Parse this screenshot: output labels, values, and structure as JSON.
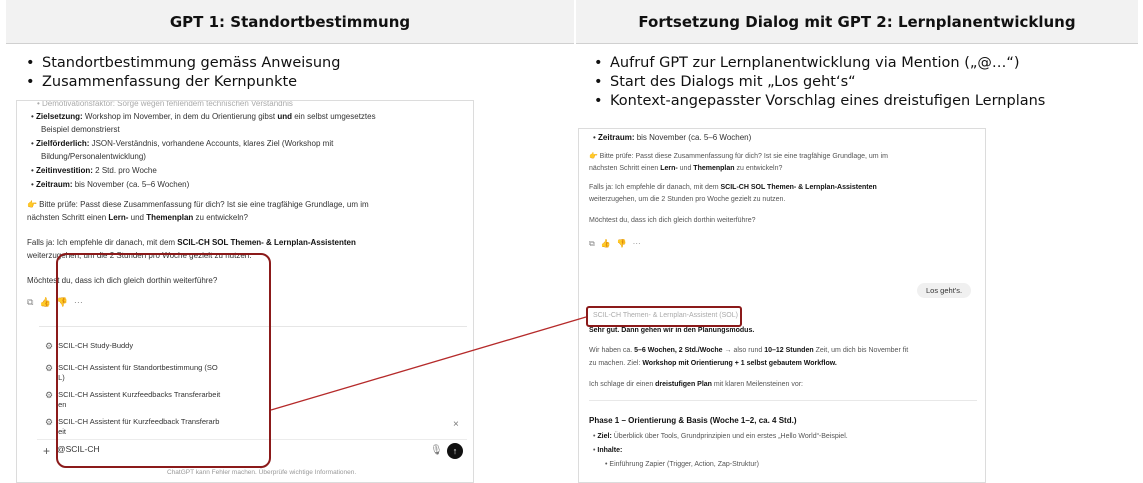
{
  "headers": {
    "left": "GPT 1: Standortbestimmung",
    "right": "Fortsetzung Dialog mit GPT 2: Lernplanentwicklung"
  },
  "bullets_left": [
    "Standortbestimmung gemäss Anweisung",
    "Zusammenfassung der Kernpunkte"
  ],
  "bullets_right": [
    "Aufruf GPT zur Lernplanentwicklung via Mention („@…“)",
    "Start des Dialogs mit „Los geht‘s“",
    "Kontext-angepasster Vorschlag eines dreistufigen Lernplans"
  ],
  "left_screenshot": {
    "cut_top_line": "Demotivationsfaktor: Sorge wegen fehlendem technischen Verständnis",
    "bullets": [
      {
        "bold": "Zielsetzung:",
        "text_1": " Workshop im November, in dem du Orientierung gibst ",
        "bold_2": "und",
        "text_2": " ein selbst umgesetztes"
      },
      {
        "cont": "Beispiel demonstrierst"
      },
      {
        "bold": "Zielförderlich:",
        "text_1": " JSON-Verständnis, vorhandene Accounts, klares Ziel (Workshop mit"
      },
      {
        "cont": "Bildung/Personalentwicklung)"
      },
      {
        "bold": "Zeitinvestition:",
        "text_1": " 2 Std. pro Woche"
      },
      {
        "bold": "Zeitraum:",
        "text_1": " bis November (ca. 5–6 Wochen)"
      }
    ],
    "check_prefix": "👉 Bitte prüfe: Passt diese Zusammenfassung für dich? Ist sie eine tragfähige Grundlage, um im",
    "check_line2_a": "nächsten Schritt einen ",
    "check_line2_b": "Lern-",
    "check_line2_c": " und ",
    "check_line2_d": "Themenplan",
    "check_line2_e": " zu entwickeln?",
    "ifyes_a": "Falls ja: Ich empfehle dir danach, mit dem ",
    "ifyes_b": "SCIL-CH SOL Themen- & Lernplan-Assistenten",
    "ifyes_line2": "weiterzugehen, um die 2 Stunden pro Woche gezielt zu nutzen.",
    "question": "Möchtest du, dass ich dich gleich dorthin weiterführe?",
    "action_icons": "⧉  ♡  ♡  ···",
    "suggestions": [
      "SCIL-CH Study-Buddy",
      "SCIL-CH Assistent für Standortbestimmung (SO",
      "L)",
      "SCIL-CH Assistent Kurzfeedbacks Transferarbeit",
      "en",
      "SCIL-CH Assistent für Kurzfeedback Transferarb",
      "eit"
    ],
    "close_symbol": "×",
    "input_value": "@SCIL-CH",
    "footer": "ChatGPT kann Fehler machen. Überprüfe wichtige Informationen."
  },
  "right_screenshot": {
    "timeframe_bold": "Zeitraum:",
    "timeframe_text": " bis November (ca. 5–6 Wochen)",
    "check_line1": "👉 Bitte prüfe: Passt diese Zusammenfassung für dich? Ist sie eine tragfähige Grundlage, um im",
    "check_line2_a": "nächsten Schritt einen ",
    "check_line2_b": "Lern-",
    "check_line2_c": " und ",
    "check_line2_d": "Themenplan",
    "check_line2_e": " zu entwickeln?",
    "ifyes_a": "Falls ja: Ich empfehle dir danach, mit dem ",
    "ifyes_b": "SCIL-CH SOL Themen- & Lernplan-Assistenten",
    "ifyes_line2": "weiterzugehen, um die 2 Stunden pro Woche gezielt zu nutzen.",
    "question": "Möchtest du, dass ich dich gleich dorthin weiterführe?",
    "action_icons": "⧉  ♡  ♡  ···",
    "user_bubble": "Los geht's.",
    "assistant_label": "SCIL-CH Themen- & Lernplan-Assistent (SOL)",
    "intro_bold": "Sehr gut. Dann gehen wir in den Planungsmodus.",
    "p2_a": "Wir haben ca. ",
    "p2_b": "5–6 Wochen, 2 Std./Woche",
    "p2_c": " → also rund ",
    "p2_d": "10–12 Stunden",
    "p2_e": " Zeit, um dich bis November fit",
    "p2_line2_a": "zu machen. Ziel: ",
    "p2_line2_b": "Workshop mit Orientierung + 1 selbst gebautem Workflow.",
    "p3_a": "Ich schlage dir einen ",
    "p3_b": "dreistufigen Plan",
    "p3_c": " mit klaren Meilensteinen vor:",
    "phase_title": "Phase 1 – Orientierung & Basis (Woche 1–2, ca. 4 Std.)",
    "phase_goal_a": "Ziel:",
    "phase_goal_b": " Überblick über Tools, Grundprinzipien und ein erstes „Hello World“-Beispiel.",
    "phase_content": "Inhalte:",
    "phase_item": "Einführung Zapier (Trigger, Action, Zap-Struktur)"
  }
}
